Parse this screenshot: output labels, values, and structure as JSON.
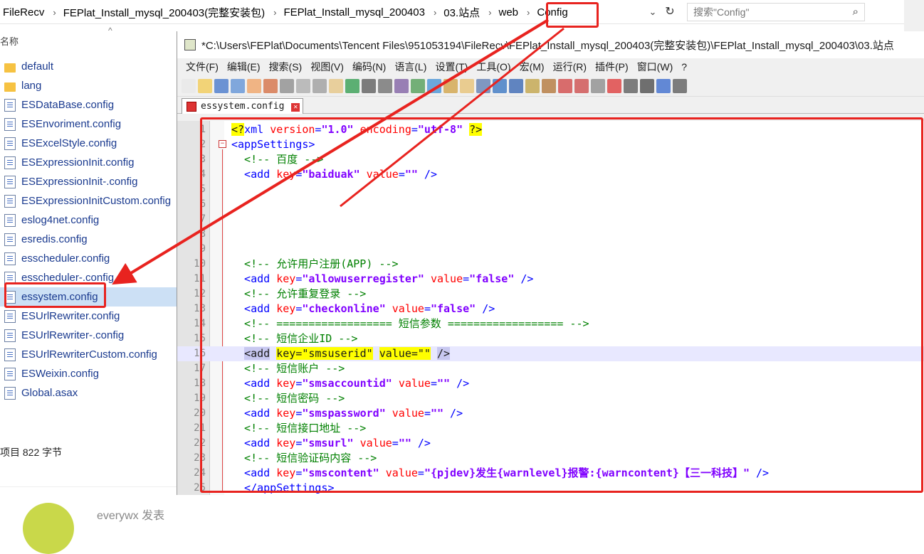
{
  "address_bar": {
    "crumbs": [
      "FileRecv",
      "FEPlat_Install_mysql_200403(完整安装包)",
      "FEPlat_Install_mysql_200403",
      "03.站点",
      "web",
      "Config"
    ],
    "separator": "›",
    "search_placeholder": "搜索\"Config\""
  },
  "explorer": {
    "column_header": "名称",
    "files": [
      {
        "name": "default",
        "icon": "folder-icon"
      },
      {
        "name": "lang",
        "icon": "folder-icon"
      },
      {
        "name": "ESDataBase.config",
        "icon": "config-file-icon"
      },
      {
        "name": "ESEnvoriment.config",
        "icon": "config-file-icon"
      },
      {
        "name": "ESExcelStyle.config",
        "icon": "config-file-icon"
      },
      {
        "name": "ESExpressionInit.config",
        "icon": "config-file-icon"
      },
      {
        "name": "ESExpressionInit-.config",
        "icon": "config-file-icon"
      },
      {
        "name": "ESExpressionInitCustom.config",
        "icon": "config-file-icon"
      },
      {
        "name": "eslog4net.config",
        "icon": "config-file-icon"
      },
      {
        "name": "esredis.config",
        "icon": "config-file-icon"
      },
      {
        "name": "esscheduler.config",
        "icon": "config-file-icon"
      },
      {
        "name": "esscheduler-.config",
        "icon": "config-file-icon"
      },
      {
        "name": "essystem.config",
        "icon": "config-file-icon",
        "selected": true
      },
      {
        "name": "ESUrlRewriter.config",
        "icon": "config-file-icon"
      },
      {
        "name": "ESUrlRewriter-.config",
        "icon": "config-file-icon"
      },
      {
        "name": "ESUrlRewriterCustom.config",
        "icon": "config-file-icon"
      },
      {
        "name": "ESWeixin.config",
        "icon": "config-file-icon"
      },
      {
        "name": "Global.asax",
        "icon": "asax-file-icon"
      }
    ],
    "status_text": "项目   822 字节",
    "bottom_user": "everywx  发表"
  },
  "notepad": {
    "title": "*C:\\Users\\FEPlat\\Documents\\Tencent Files\\951053194\\FileRecv\\FEPlat_Install_mysql_200403(完整安装包)\\FEPlat_Install_mysql_200403\\03.站点",
    "menu": [
      "文件(F)",
      "编辑(E)",
      "搜索(S)",
      "视图(V)",
      "编码(N)",
      "语言(L)",
      "设置(T)",
      "工具(O)",
      "宏(M)",
      "运行(R)",
      "插件(P)",
      "窗口(W)",
      "?"
    ],
    "tab_label": "essystem.config",
    "highlighted_line": 16,
    "lines": [
      {
        "n": "1",
        "code": [
          [
            "hltag",
            "<?"
          ],
          [
            "tag",
            "xml "
          ],
          [
            "attr",
            "version"
          ],
          [
            "tag",
            "="
          ],
          [
            "val",
            "\"1.0\""
          ],
          [
            "tag",
            " "
          ],
          [
            "attr",
            "encoding"
          ],
          [
            "tag",
            "="
          ],
          [
            "val",
            "\"utf-8\""
          ],
          [
            "tag",
            " "
          ],
          [
            "hltag",
            "?>"
          ]
        ]
      },
      {
        "n": "2",
        "code": [
          [
            "tag",
            "<appSettings>"
          ]
        ]
      },
      {
        "n": "3",
        "code": [
          [
            "cmt",
            "  <!-- 百度 -->"
          ]
        ]
      },
      {
        "n": "4",
        "code": [
          [
            "tag",
            "  <add "
          ],
          [
            "attr",
            "key"
          ],
          [
            "tag",
            "="
          ],
          [
            "val",
            "\"baiduak\""
          ],
          [
            "tag",
            " "
          ],
          [
            "attr",
            "value"
          ],
          [
            "tag",
            "="
          ],
          [
            "val",
            "\"\""
          ],
          [
            "tag",
            " />"
          ]
        ]
      },
      {
        "n": "5",
        "code": []
      },
      {
        "n": "6",
        "code": []
      },
      {
        "n": "7",
        "code": []
      },
      {
        "n": "8",
        "code": []
      },
      {
        "n": "9",
        "code": []
      },
      {
        "n": "10",
        "code": [
          [
            "cmt",
            "  <!-- 允许用户注册(APP) -->"
          ]
        ]
      },
      {
        "n": "11",
        "code": [
          [
            "tag",
            "  <add "
          ],
          [
            "attr",
            "key"
          ],
          [
            "tag",
            "="
          ],
          [
            "val",
            "\"allowuserregister\""
          ],
          [
            "tag",
            " "
          ],
          [
            "attr",
            "value"
          ],
          [
            "tag",
            "="
          ],
          [
            "val",
            "\"false\""
          ],
          [
            "tag",
            " />"
          ]
        ]
      },
      {
        "n": "12",
        "code": [
          [
            "cmt",
            "  <!-- 允许重复登录 -->"
          ]
        ]
      },
      {
        "n": "13",
        "code": [
          [
            "tag",
            "  <add "
          ],
          [
            "attr",
            "key"
          ],
          [
            "tag",
            "="
          ],
          [
            "val",
            "\"checkonline\""
          ],
          [
            "tag",
            " "
          ],
          [
            "attr",
            "value"
          ],
          [
            "tag",
            "="
          ],
          [
            "val",
            "\"false\""
          ],
          [
            "tag",
            " />"
          ]
        ]
      },
      {
        "n": "14",
        "code": [
          [
            "cmt",
            "  <!-- ================== 短信参数 ================== -->"
          ]
        ]
      },
      {
        "n": "15",
        "code": [
          [
            "cmt",
            "  <!-- 短信企业ID -->"
          ]
        ]
      },
      {
        "n": "16",
        "code": [
          [
            "tag",
            "  "
          ],
          [
            "hlsel",
            "<add"
          ],
          [
            "tag",
            " "
          ],
          [
            "hltag",
            "key=\"smsuserid\""
          ],
          [
            "tag",
            " "
          ],
          [
            "hltag",
            "value=\"\""
          ],
          [
            "tag",
            " "
          ],
          [
            "hlsel",
            "/>"
          ]
        ]
      },
      {
        "n": "17",
        "code": [
          [
            "cmt",
            "  <!-- 短信账户 -->"
          ]
        ]
      },
      {
        "n": "18",
        "code": [
          [
            "tag",
            "  <add "
          ],
          [
            "attr",
            "key"
          ],
          [
            "tag",
            "="
          ],
          [
            "val",
            "\"smsaccountid\""
          ],
          [
            "tag",
            " "
          ],
          [
            "attr",
            "value"
          ],
          [
            "tag",
            "="
          ],
          [
            "val",
            "\"\""
          ],
          [
            "tag",
            " />"
          ]
        ]
      },
      {
        "n": "19",
        "code": [
          [
            "cmt",
            "  <!-- 短信密码 -->"
          ]
        ]
      },
      {
        "n": "20",
        "code": [
          [
            "tag",
            "  <add "
          ],
          [
            "attr",
            "key"
          ],
          [
            "tag",
            "="
          ],
          [
            "val",
            "\"smspassword\""
          ],
          [
            "tag",
            " "
          ],
          [
            "attr",
            "value"
          ],
          [
            "tag",
            "="
          ],
          [
            "val",
            "\"\""
          ],
          [
            "tag",
            " />"
          ]
        ]
      },
      {
        "n": "21",
        "code": [
          [
            "cmt",
            "  <!-- 短信接口地址 -->"
          ]
        ]
      },
      {
        "n": "22",
        "code": [
          [
            "tag",
            "  <add "
          ],
          [
            "attr",
            "key"
          ],
          [
            "tag",
            "="
          ],
          [
            "val",
            "\"smsurl\""
          ],
          [
            "tag",
            " "
          ],
          [
            "attr",
            "value"
          ],
          [
            "tag",
            "="
          ],
          [
            "val",
            "\"\""
          ],
          [
            "tag",
            " />"
          ]
        ]
      },
      {
        "n": "23",
        "code": [
          [
            "cmt",
            "  <!-- 短信验证码内容 -->"
          ]
        ]
      },
      {
        "n": "24",
        "code": [
          [
            "tag",
            "  <add "
          ],
          [
            "attr",
            "key"
          ],
          [
            "tag",
            "="
          ],
          [
            "val",
            "\"smscontent\""
          ],
          [
            "tag",
            " "
          ],
          [
            "attr",
            "value"
          ],
          [
            "tag",
            "="
          ],
          [
            "val",
            "\"{pjdev}发生{warnlevel}报警:{warncontent}【三一科技】\""
          ],
          [
            "tag",
            " />"
          ]
        ]
      },
      {
        "n": "25",
        "code": [
          [
            "tag",
            "  </appSettings>"
          ]
        ]
      }
    ]
  },
  "colors": {
    "annotation_red": "#e8231f",
    "selection": "#cce0f5"
  }
}
